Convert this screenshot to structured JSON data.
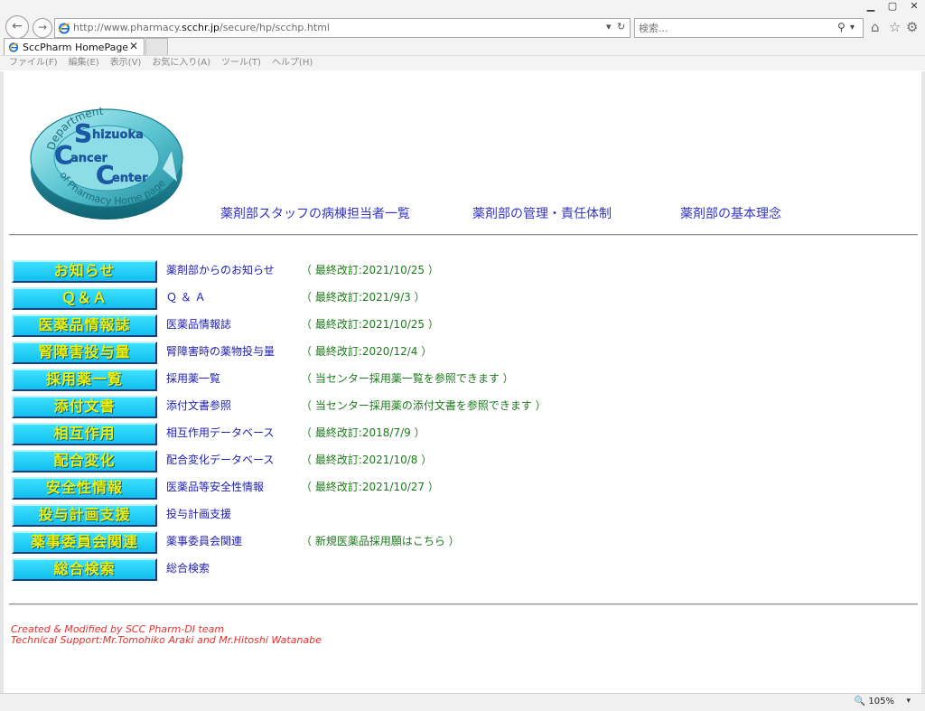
{
  "browser": {
    "url_prefix": "http://www.pharmacy.",
    "url_domain": "scchr.jp",
    "url_path": "/secure/hp/scchp.html",
    "search_placeholder": "検索...",
    "tab_title": "SccPharm HomePage",
    "menu": [
      "ファイル(F)",
      "編集(E)",
      "表示(V)",
      "お気に入り(A)",
      "ツール(T)",
      "ヘルプ(H)"
    ],
    "zoom": "105%"
  },
  "logo": {
    "s1": "S",
    "w1": "hizuoka",
    "s2": "C",
    "w2": "ancer",
    "s3": "C",
    "w3": "enter",
    "top_arc": "Department",
    "bottom_arc": "of Pharmacy Home page"
  },
  "top_links": [
    "薬剤部スタッフの病棟担当者一覧",
    "薬剤部の管理・責任体制",
    "薬剤部の基本理念"
  ],
  "rows": [
    {
      "button": "お知らせ",
      "link": "薬剤部からのお知らせ",
      "note": "（ 最終改訂:2021/10/25 ）"
    },
    {
      "button": "Ｑ＆Ａ",
      "link": "Ｑ ＆ Ａ",
      "note": "（ 最終改訂:2021/9/3 ）"
    },
    {
      "button": "医薬品情報誌",
      "link": "医薬品情報誌",
      "note": "（ 最終改訂:2021/10/25 ）"
    },
    {
      "button": "腎障害投与量",
      "link": "腎障害時の薬物投与量",
      "note": "（ 最終改訂:2020/12/4 ）"
    },
    {
      "button": "採用薬一覧",
      "link": "採用薬一覧",
      "note": "（ 当センター採用薬一覧を参照できます ）"
    },
    {
      "button": "添付文書",
      "link": "添付文書参照",
      "note": "（ 当センター採用薬の添付文書を参照できます ）"
    },
    {
      "button": "相互作用",
      "link": "相互作用データベース",
      "note": "（ 最終改訂:2018/7/9 ）"
    },
    {
      "button": "配合変化",
      "link": "配合変化データベース",
      "note": "（ 最終改訂:2021/10/8 ）"
    },
    {
      "button": "安全性情報",
      "link": "医薬品等安全性情報",
      "note": "（ 最終改訂:2021/10/27 ）"
    },
    {
      "button": "投与計画支援",
      "link": "投与計画支援",
      "note": ""
    },
    {
      "button": "薬事委員会関連",
      "link": "薬事委員会関連",
      "note": "（ 新規医薬品採用願はこちら ）"
    },
    {
      "button": "総合検索",
      "link": "総合検索",
      "note": ""
    }
  ],
  "credits": {
    "line1": "Created & Modified by SCC Pharm-DI team",
    "line2": "Technical Support:Mr.Tomohiko Araki and Mr.Hitoshi Watanabe"
  },
  "colors": {
    "button_bg": "#1ccfff",
    "button_text": "#f0f000",
    "link": "#2020b8",
    "note": "#1c7a1c",
    "credits": "#e8302b"
  }
}
